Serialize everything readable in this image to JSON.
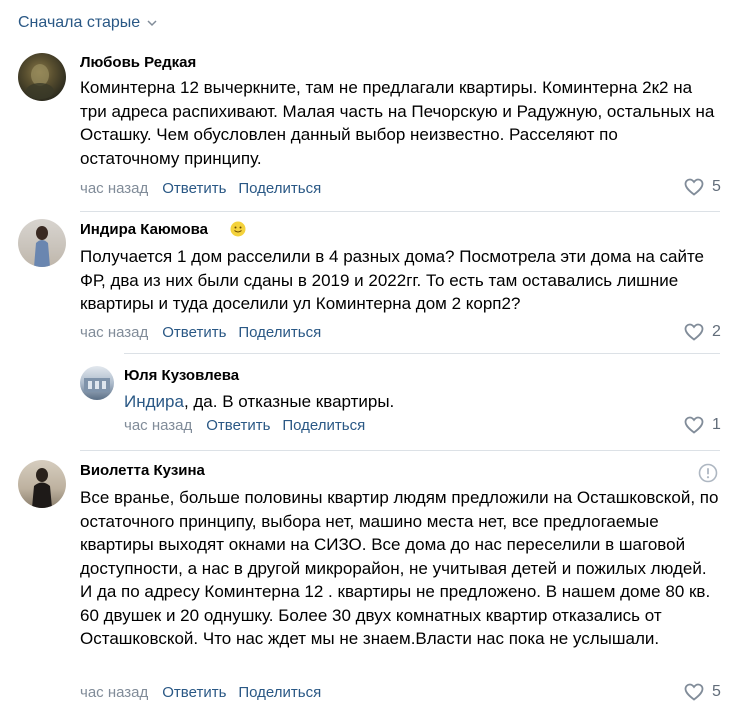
{
  "sort": {
    "label": "Сначала старые",
    "icon": "chevron-down-icon"
  },
  "comments": [
    {
      "author": "Любовь Редкая",
      "text": "Коминтерна 12 вычеркните, там не предлагали квартиры. Коминтерна 2к2 на три адреса распихивают. Малая часть на Печорскую и Радужную, остальных на Осташку. Чем обусловлен данный выбор неизвестно. Расселяют по остаточному принципу.",
      "time": "час назад",
      "reply": "Ответить",
      "share": "Поделиться",
      "likes": "5"
    },
    {
      "author": "Индира Каюмова",
      "badge_icon": "smiley-icon",
      "text": "Получается 1 дом расселили в 4 разных дома? Посмотрела эти дома на сайте ФР, два из них были сданы в 2019 и 2022гг. То есть там оставались лишние квартиры и туда доселили ул Коминтерна дом 2 корп2?",
      "time": "час назад",
      "reply": "Ответить",
      "share": "Поделиться",
      "likes": "2"
    },
    {
      "author": "Юля Кузовлева",
      "mention": "Индира",
      "text": ", да. В отказные квартиры.",
      "time": "час назад",
      "reply": "Ответить",
      "share": "Поделиться",
      "likes": "1"
    },
    {
      "author": "Виолетта Кузина",
      "text": "Все вранье, больше половины квартир людям предложили на Осташковской, по остаточного принципу, выбора нет, машино места нет, все предлогаемые квартиры выходят окнами на СИЗО. Все дома до нас переселили в шаговой доступности, а нас в другой микрорайон, не учитывая детей и пожилых людей. И да по адресу Коминтерна 12 . квартиры не предложено. В нашем доме 80 кв. 60 двушек и 20 однушку. Более 30 двух комнатных квартир отказались от Осташковской. Что нас ждет мы не знаем.Власти нас пока не услышали.",
      "time": "час назад",
      "reply": "Ответить",
      "share": "Поделиться",
      "likes": "5"
    }
  ],
  "colors": {
    "link": "#2a5885",
    "meta": "#818c99",
    "separator": "#dce1e6"
  }
}
